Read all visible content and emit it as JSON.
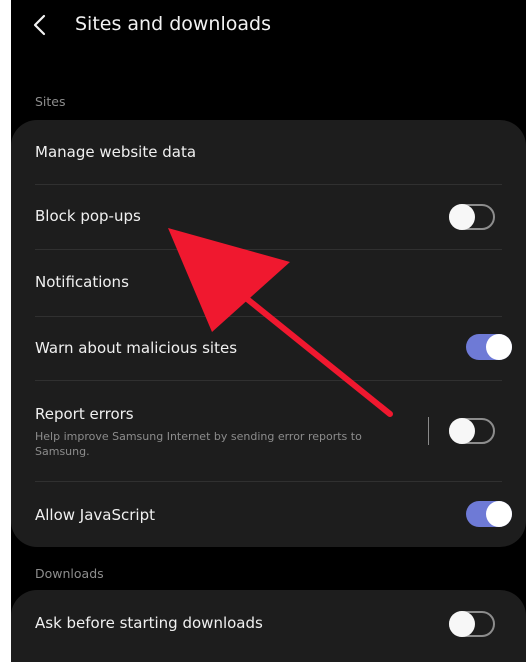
{
  "header": {
    "title": "Sites and downloads",
    "back_icon": "chevron-left-icon"
  },
  "sections": {
    "sites": {
      "label": "Sites",
      "items": [
        {
          "label": "Manage website data"
        },
        {
          "label": "Block pop-ups",
          "toggle": "off"
        },
        {
          "label": "Notifications"
        },
        {
          "label": "Warn about malicious sites",
          "toggle": "on"
        },
        {
          "label": "Report errors",
          "sublabel": "Help improve Samsung Internet by sending error reports to Samsung.",
          "toggle": "off"
        },
        {
          "label": "Allow JavaScript",
          "toggle": "on"
        }
      ]
    },
    "downloads": {
      "label": "Downloads",
      "items": [
        {
          "label": "Ask before starting downloads",
          "toggle": "off"
        }
      ]
    }
  },
  "colors": {
    "background": "#000000",
    "card": "#1d1d1d",
    "toggle_on": "#6e7ad6",
    "annotation_arrow": "#f0182f"
  }
}
